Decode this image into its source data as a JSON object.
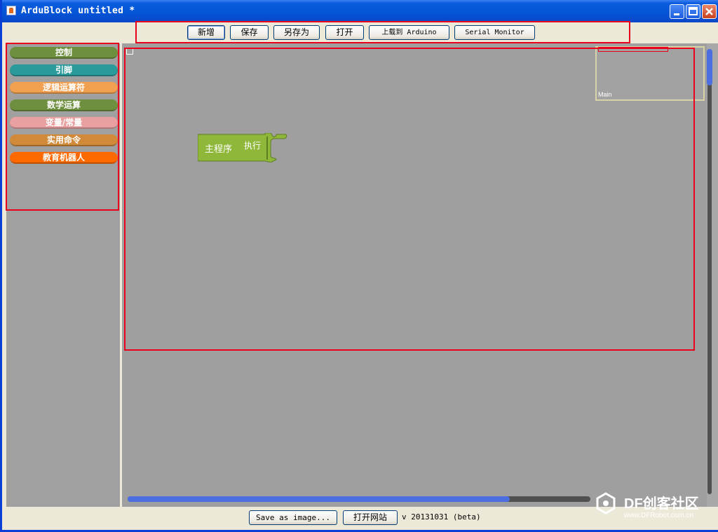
{
  "window": {
    "title": "ArduBlock untitled *",
    "controls": {
      "minimize": "minimize-icon",
      "maximize": "maximize-icon",
      "close": "close-icon"
    }
  },
  "toolbar": {
    "buttons": [
      {
        "label": "新增"
      },
      {
        "label": "保存"
      },
      {
        "label": "另存为"
      },
      {
        "label": "打开"
      },
      {
        "label": "上载到 Arduino"
      },
      {
        "label": "Serial Monitor"
      }
    ]
  },
  "categories": [
    {
      "label": "控制",
      "color": "#6e8f3e"
    },
    {
      "label": "引脚",
      "color": "#2a9a9a"
    },
    {
      "label": "逻辑运算符",
      "color": "#f0a050"
    },
    {
      "label": "数学运算",
      "color": "#6e8f3e"
    },
    {
      "label": "变量/常量",
      "color": "#e8a0a0"
    },
    {
      "label": "实用命令",
      "color": "#d08a3a"
    },
    {
      "label": "教育机器人",
      "color": "#ff6a00"
    }
  ],
  "canvas": {
    "block": {
      "label": "主程序",
      "action_label": "执行",
      "color": "#8fb83a"
    },
    "minimap_label": "Main"
  },
  "statusbar": {
    "save_image_label": "Save as image...",
    "open_site_label": "打开网站",
    "version": "v 20131031  (beta)"
  },
  "watermark": {
    "brand": "DF创客社区",
    "url": "www.DFRobot.com.cn"
  },
  "colors": {
    "highlight": "#e8001c",
    "scroll_thumb": "#4b6ee0"
  }
}
